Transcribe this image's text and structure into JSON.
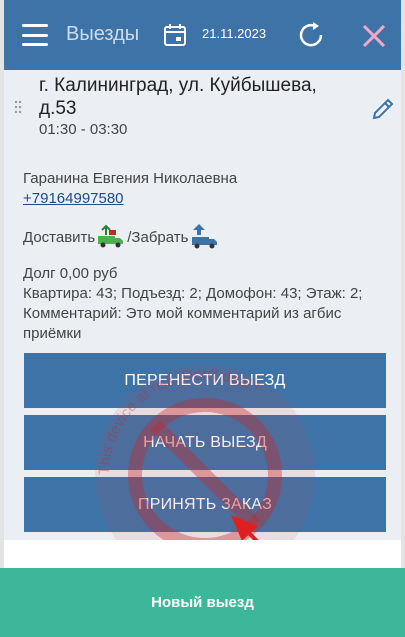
{
  "header": {
    "title": "Выезды",
    "date": "21.11.2023",
    "menu_icon": "hamburger-menu-icon",
    "calendar_icon": "calendar-icon",
    "refresh_icon": "refresh-icon",
    "close_icon": "close-icon"
  },
  "visit": {
    "address": "г. Калининград, ул. Куйбышева, д.53",
    "time": "01:30 - 03:30",
    "client_name": "Гаранина Евгения Николаевна",
    "phone": "+79164997580",
    "deliver_label": "Доставить",
    "separator": "/",
    "pickup_label": "Забрать",
    "debt": "Долг 0,00 руб",
    "details": "Квартира: 43; Подъезд: 2; Домофон: 43; Этаж: 2;",
    "comment": "Комментарий: Это мой комментарий из агбис приёмки"
  },
  "buttons": {
    "reschedule": "ПЕРЕНЕСТИ ВЫЕЗД",
    "start": "НАЧАТЬ ВЫЕЗД",
    "accept": "ПРИНЯТЬ ЗАКАЗ"
  },
  "footer": {
    "new_visit": "Новый выезд"
  },
  "watermark": {
    "text": "This device at risk. Don't deal !"
  },
  "colors": {
    "header": "#3e73a8",
    "button": "#3e73a8",
    "footer": "#3cb79a",
    "content_bg": "#ebeff3",
    "deliver_truck": "#4caf50",
    "pickup_truck": "#3e73a8",
    "arrow": "#e02020"
  }
}
